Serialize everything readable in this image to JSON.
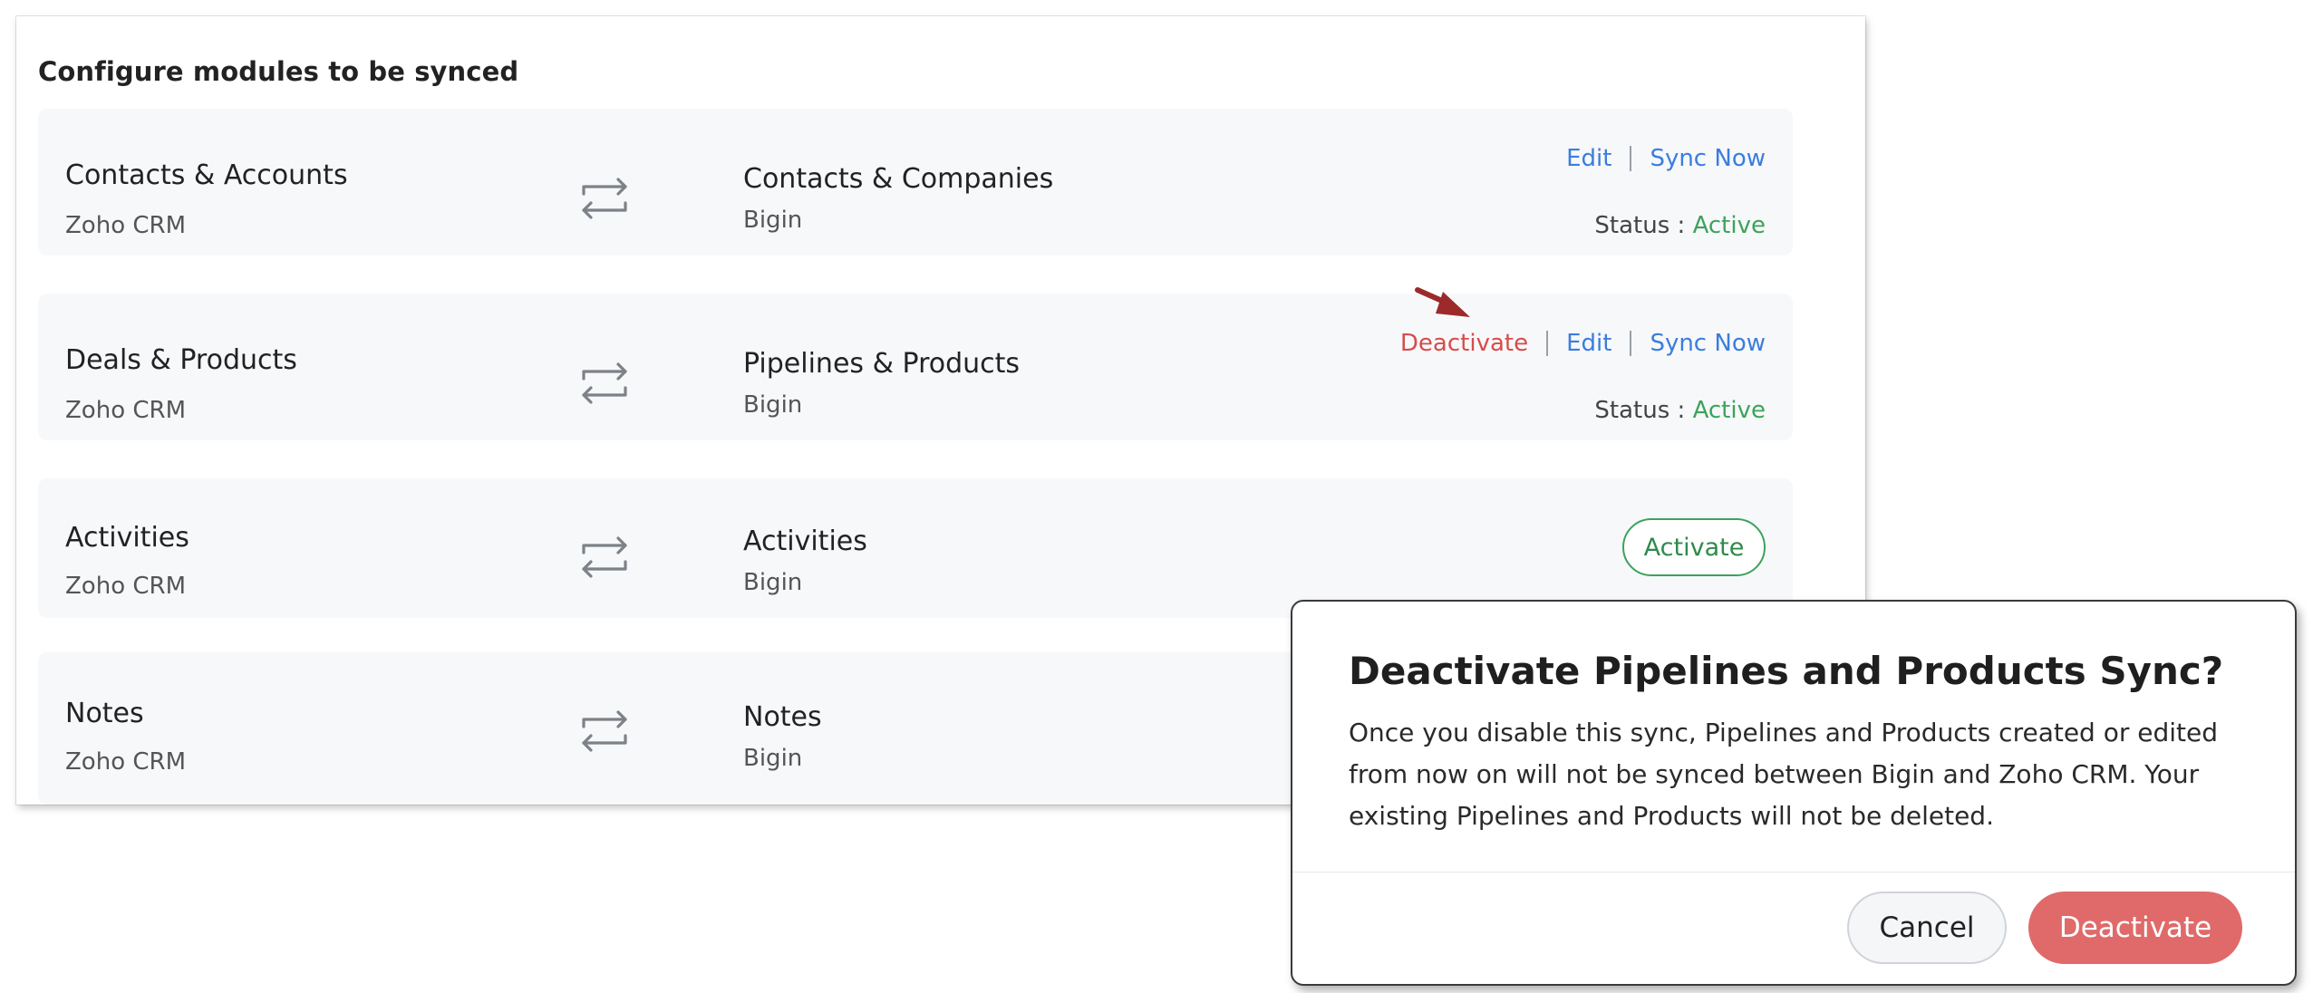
{
  "panel": {
    "title": "Configure modules to be synced"
  },
  "modules": [
    {
      "source_name": "Contacts & Accounts",
      "source_app": "Zoho CRM",
      "target_name": "Contacts & Companies",
      "target_app": "Bigin",
      "actions": {
        "edit": "Edit",
        "sync_now": "Sync Now"
      },
      "status_label": "Status",
      "status_sep": ":",
      "status_value": "Active"
    },
    {
      "source_name": "Deals & Products",
      "source_app": "Zoho CRM",
      "target_name": "Pipelines & Products",
      "target_app": "Bigin",
      "actions": {
        "deactivate": "Deactivate",
        "edit": "Edit",
        "sync_now": "Sync Now"
      },
      "status_label": "Status",
      "status_sep": ":",
      "status_value": "Active"
    },
    {
      "source_name": "Activities",
      "source_app": "Zoho CRM",
      "target_name": "Activities",
      "target_app": "Bigin",
      "activate_label": "Activate"
    },
    {
      "source_name": "Notes",
      "source_app": "Zoho CRM",
      "target_name": "Notes",
      "target_app": "Bigin"
    }
  ],
  "dialog": {
    "title": "Deactivate Pipelines and Products Sync?",
    "body": "Once you disable this sync, Pipelines and Products created or edited from now on will not be synced between Bigin and Zoho CRM. Your existing Pipelines and Products will not be deleted.",
    "cancel_label": "Cancel",
    "confirm_label": "Deactivate"
  },
  "icons": {
    "sync": "sync-arrows-icon",
    "pointer": "pointer-arrow-icon"
  },
  "colors": {
    "link": "#3b7ddd",
    "danger": "#d64c4c",
    "active": "#3ca35c",
    "confirm_button": "#e06a6a",
    "row_background": "#f7f8fa"
  }
}
